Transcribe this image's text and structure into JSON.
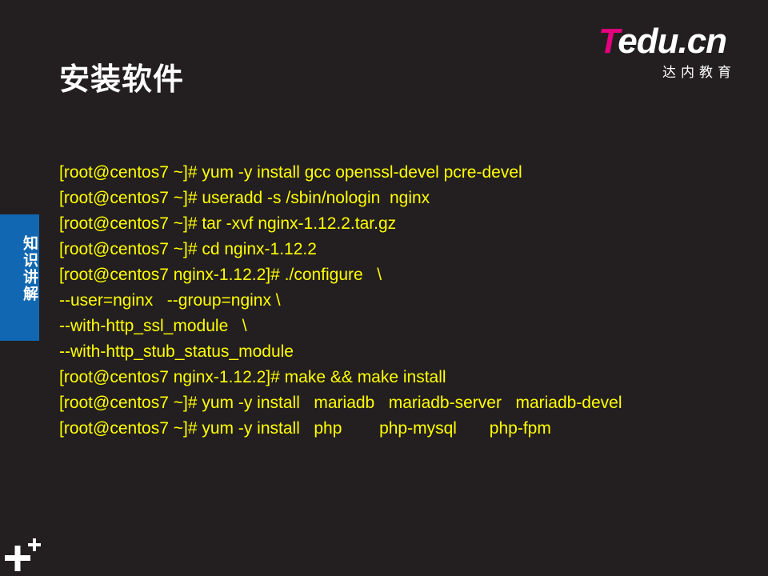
{
  "slide": {
    "title": "安装软件",
    "side_tab_label": "知识讲解"
  },
  "logo": {
    "wordmark_first": "T",
    "wordmark_rest": "edu.cn",
    "tagline": "达内教育",
    "brand_color": "#e6007e"
  },
  "colors": {
    "background": "#231f20",
    "code_text": "#ffff00",
    "side_tab": "#1167b1",
    "title": "#ffffff"
  },
  "icons": {
    "corner": "plus-plus-icon"
  },
  "code_lines": [
    "[root@centos7 ~]# yum -y install gcc openssl-devel pcre-devel",
    "[root@centos7 ~]# useradd -s /sbin/nologin  nginx",
    "[root@centos7 ~]# tar -xvf nginx-1.12.2.tar.gz",
    "[root@centos7 ~]# cd nginx-1.12.2",
    "[root@centos7 nginx-1.12.2]# ./configure   \\",
    "--user=nginx   --group=nginx \\",
    "--with-http_ssl_module   \\",
    "--with-http_stub_status_module",
    "[root@centos7 nginx-1.12.2]# make && make install",
    "[root@centos7 ~]# yum -y install   mariadb   mariadb-server   mariadb-devel",
    "[root@centos7 ~]# yum -y install   php        php-mysql       php-fpm"
  ]
}
